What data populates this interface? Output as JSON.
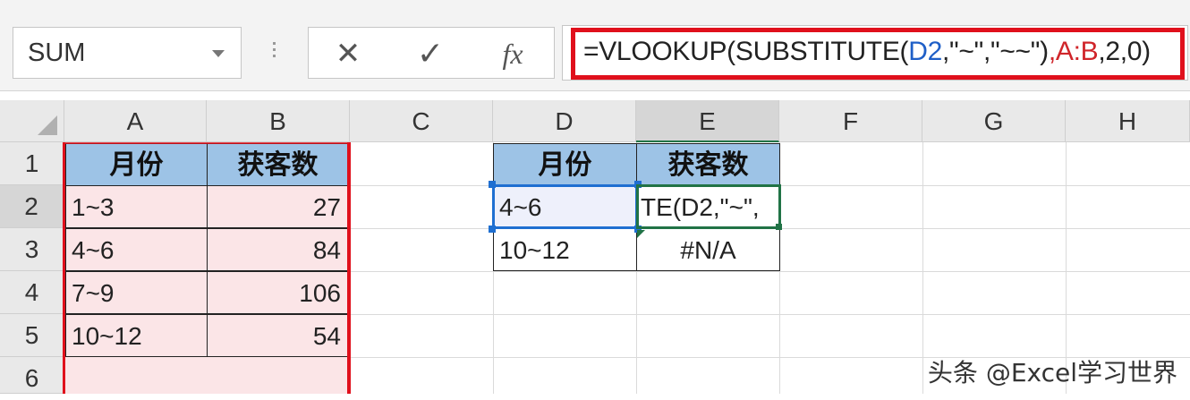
{
  "name_box": {
    "value": "SUM"
  },
  "formula_bar": {
    "cancel_icon": "✕",
    "enter_icon": "✓",
    "fx_label": "fx",
    "formula_parts": [
      "=VLOOKUP(SUBSTITUTE(",
      "D2",
      ",\"~\",\"~~\")",
      ",",
      "A:B",
      ",2,0)"
    ],
    "highlight_color": "#e0101c"
  },
  "columns": [
    "A",
    "B",
    "C",
    "D",
    "E",
    "F",
    "G",
    "H"
  ],
  "active_column": "E",
  "rows": [
    "1",
    "2",
    "3",
    "4",
    "5",
    "6"
  ],
  "active_row": "2",
  "table_left": {
    "headers": [
      "月份",
      "获客数"
    ],
    "rows": [
      [
        "1~3",
        "27"
      ],
      [
        "4~6",
        "84"
      ],
      [
        "7~9",
        "106"
      ],
      [
        "10~12",
        "54"
      ]
    ]
  },
  "table_right": {
    "headers": [
      "月份",
      "获客数"
    ],
    "rows": [
      [
        "4~6",
        "TE(D2,\"~\","
      ],
      [
        "10~12",
        "#N/A"
      ]
    ]
  },
  "colors": {
    "header_fill": "#9dc3e6",
    "lookup_fill": "#fbe5e7",
    "range_outline": "#e0101c",
    "selection": "#1f6fd1",
    "edit_border": "#217346"
  },
  "watermark": "头条 @Excel学习世界"
}
